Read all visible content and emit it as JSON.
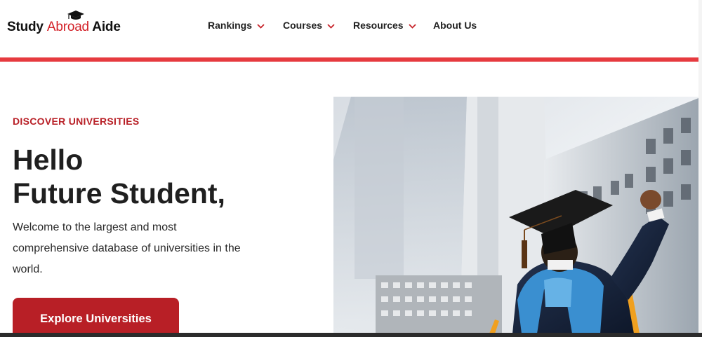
{
  "brand": {
    "word1": "Study ",
    "word2": "Abroad",
    "word3": " Aide",
    "accent_color": "#d32128"
  },
  "nav": {
    "items": [
      {
        "label": "Rankings",
        "has_dropdown": true
      },
      {
        "label": "Courses",
        "has_dropdown": true
      },
      {
        "label": "Resources",
        "has_dropdown": true
      },
      {
        "label": "About Us",
        "has_dropdown": false
      }
    ]
  },
  "hero": {
    "eyebrow": "DISCOVER UNIVERSITIES",
    "headline_line1": "Hello",
    "headline_line2": "Future Student,",
    "intro": "Welcome to the largest and most comprehensive database of universities in the world.",
    "cta_label": "Explore Universities",
    "cta_color": "#b81f26",
    "image_icon": "graduate-photo"
  },
  "colors": {
    "divider": "#e63a3f",
    "eyebrow": "#b81f26"
  }
}
